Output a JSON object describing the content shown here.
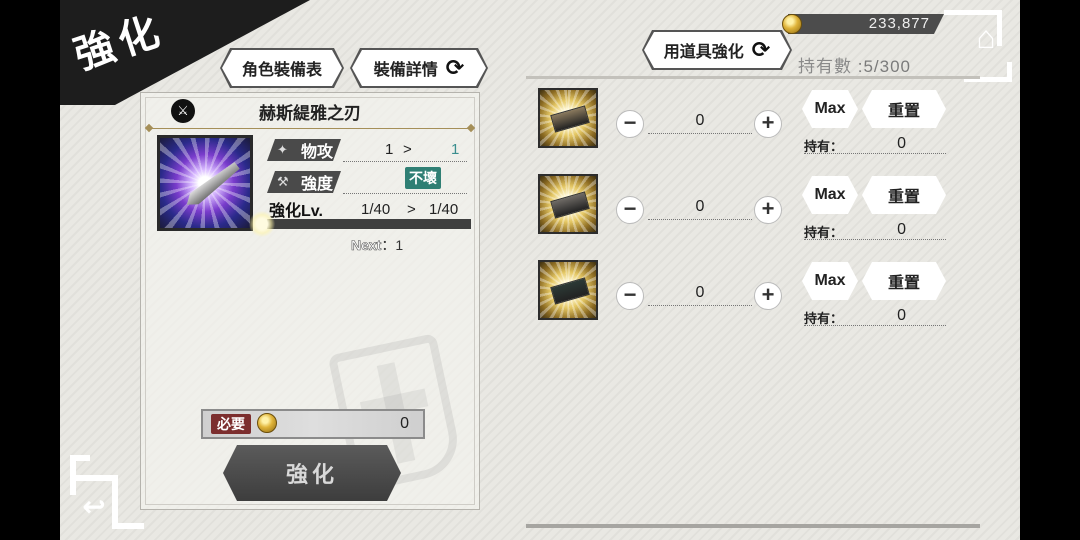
{
  "title": "強化",
  "tabs": {
    "character_equipment": "角色裝備表",
    "equipment_details": "裝備詳情",
    "item_enhance": "用道具強化"
  },
  "currency": {
    "gold": "233,877",
    "hold_label": "持有數",
    "hold_value": "5/300"
  },
  "weapon": {
    "name": "赫斯緹雅之刃",
    "type_icon": "sword-badge-icon",
    "stats": {
      "atk_label": "物攻",
      "atk_from": "1",
      "atk_arrow": ">",
      "atk_to": "1",
      "durability_label": "強度",
      "durability_value": "不壞",
      "level_label": "強化Lv.",
      "level_from": "1/40",
      "level_arrow": ">",
      "level_to": "1/40",
      "exp_progress": 0.0,
      "next_label": "Next",
      "next_sep": "：",
      "next_value": "1"
    },
    "cost": {
      "label": "必要",
      "value": "0"
    },
    "enhance_button": "強化"
  },
  "materials": [
    {
      "qty": "0",
      "max_label": "Max",
      "reset_label": "重置",
      "have_label": "持有：",
      "have_value": "0",
      "stone_color": "#8b7a5e"
    },
    {
      "qty": "0",
      "max_label": "Max",
      "reset_label": "重置",
      "have_label": "持有：",
      "have_value": "0",
      "stone_color": "#6f6b66"
    },
    {
      "qty": "0",
      "max_label": "Max",
      "reset_label": "重置",
      "have_label": "持有：",
      "have_value": "0",
      "stone_color": "#2c3a36"
    }
  ],
  "colors": {
    "accent_dark": "#1d1d1d",
    "panel_bg": "#e9e8e3",
    "teal": "#3a8e8e",
    "need_red": "#7c2e2e"
  }
}
